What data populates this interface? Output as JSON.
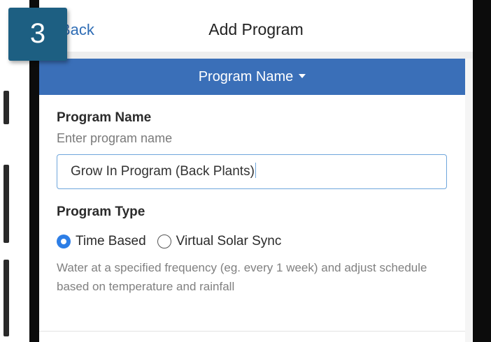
{
  "step_badge": "3",
  "nav": {
    "back_label": "Back",
    "title": "Add Program"
  },
  "section": {
    "header_label": "Program Name",
    "caret_icon": "caret-down-icon"
  },
  "form": {
    "name_label": "Program Name",
    "name_helper": "Enter program name",
    "name_value": "Grow In Program (Back Plants)",
    "type_label": "Program Type",
    "type_options": [
      {
        "label": "Time Based",
        "selected": true
      },
      {
        "label": "Virtual Solar Sync",
        "selected": false
      }
    ],
    "type_description": "Water at a specified frequency (eg. every 1 week) and adjust schedule based on temperature and rainfall"
  },
  "colors": {
    "header_bg": "#3a6fb8",
    "accent": "#2d7ee6",
    "link": "#2f6db5",
    "badge_bg": "#1d5f82"
  }
}
